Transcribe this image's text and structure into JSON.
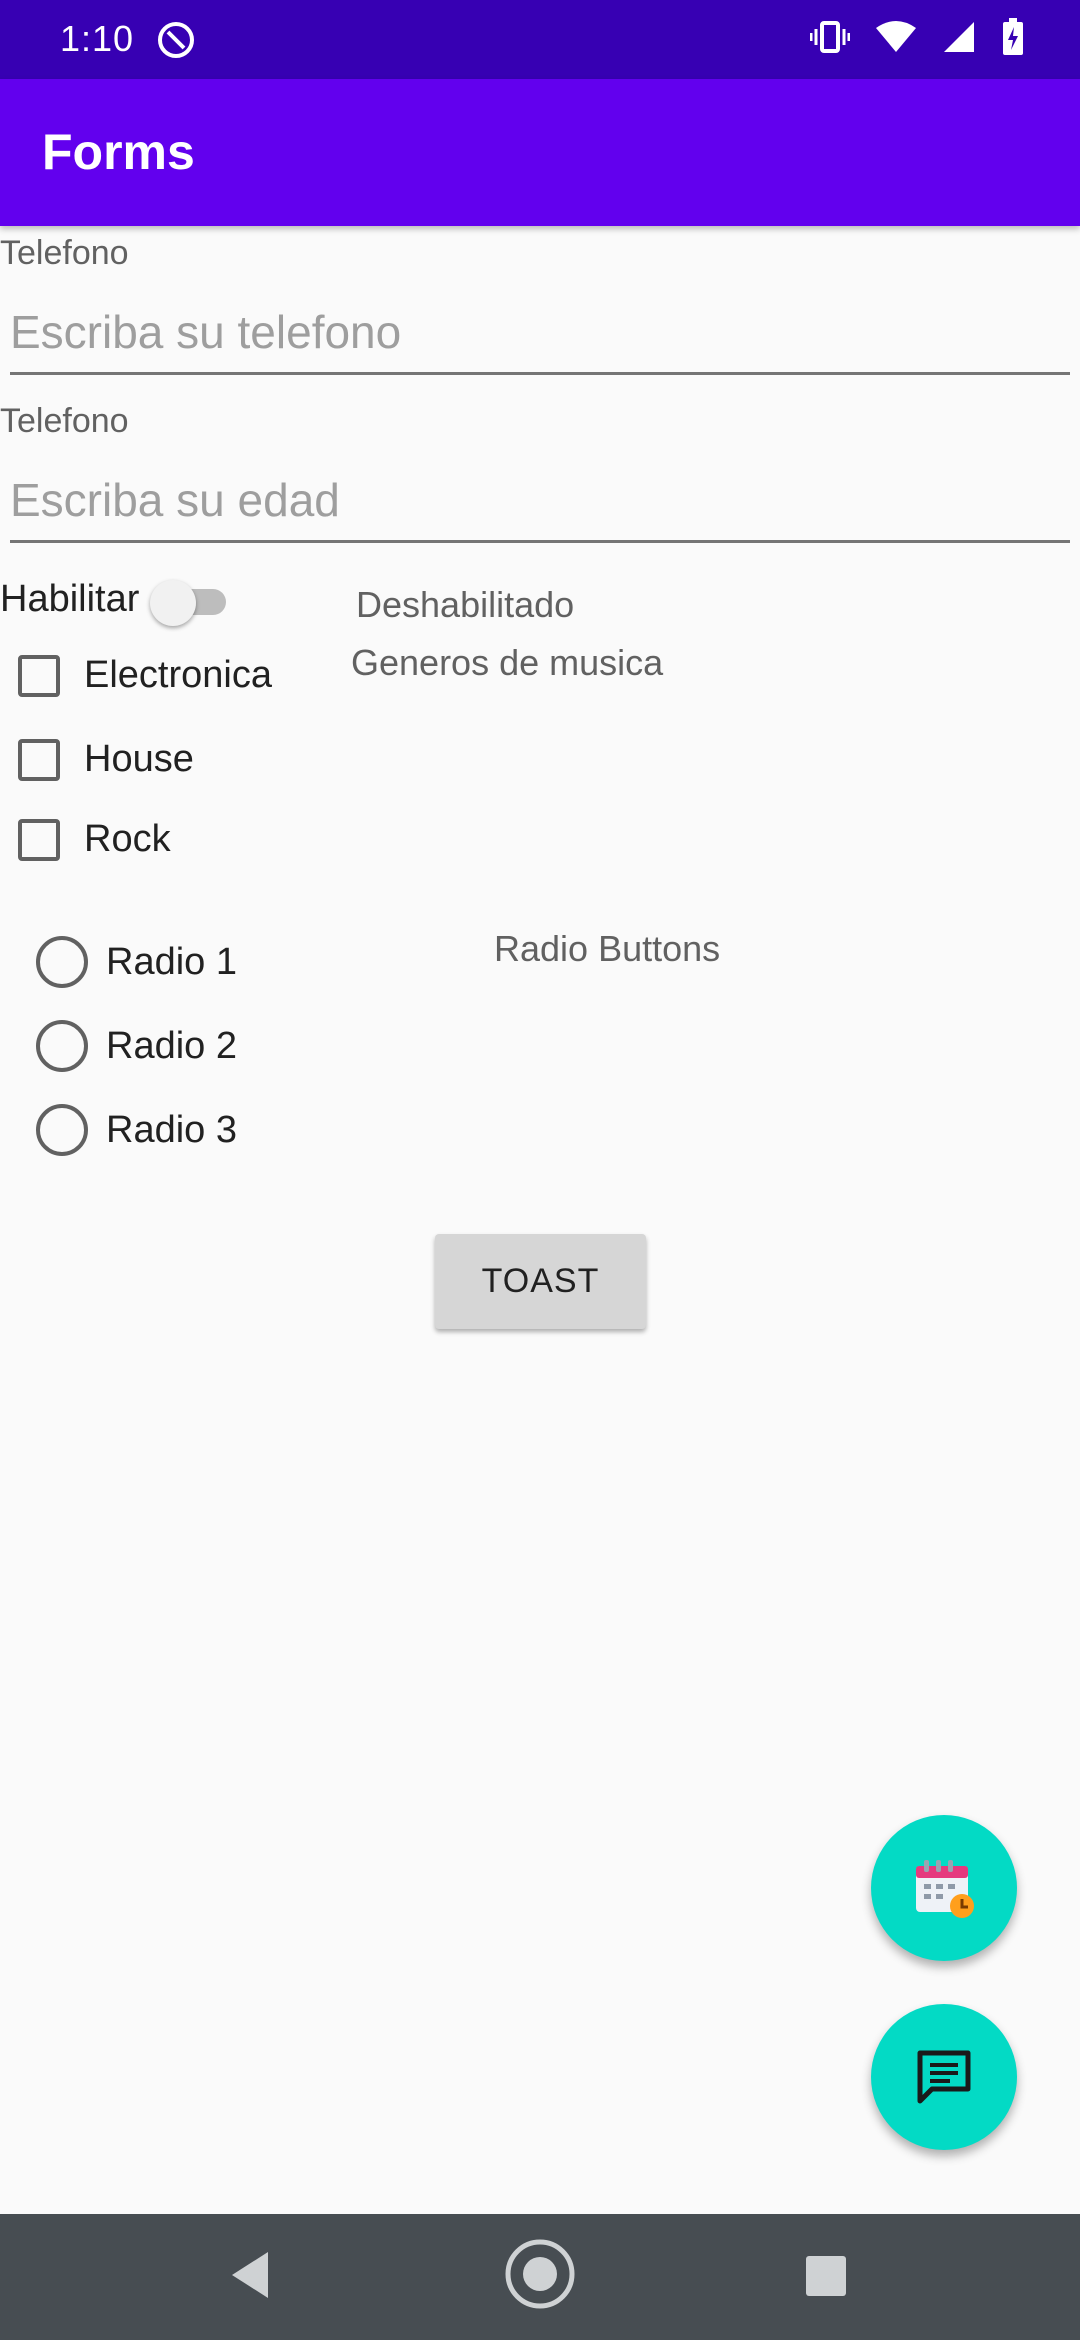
{
  "status_bar": {
    "time": "1:10"
  },
  "app_bar": {
    "title": "Forms"
  },
  "form": {
    "phone": {
      "label": "Telefono",
      "placeholder": "Escriba su telefono",
      "value": ""
    },
    "age": {
      "label": "Telefono",
      "placeholder": "Escriba su edad",
      "value": ""
    },
    "enable_switch": {
      "label": "Habilitar",
      "state_text": "Deshabilitado",
      "checked": false
    },
    "genres": {
      "title": "Generos de musica",
      "options": [
        {
          "label": "Electronica",
          "checked": false
        },
        {
          "label": "House",
          "checked": false
        },
        {
          "label": "Rock",
          "checked": false
        }
      ]
    },
    "radios": {
      "title": "Radio Buttons",
      "options": [
        {
          "label": "Radio 1",
          "selected": false
        },
        {
          "label": "Radio 2",
          "selected": false
        },
        {
          "label": "Radio 3",
          "selected": false
        }
      ]
    },
    "toast_button": {
      "label": "TOAST"
    }
  },
  "fabs": {
    "calendar_icon": "calendar-clock-icon",
    "chat_icon": "chat-message-icon",
    "color": "#03dac5"
  },
  "colors": {
    "primary": "#6200ee",
    "primary_dark": "#3700b3",
    "accent": "#03dac5"
  }
}
